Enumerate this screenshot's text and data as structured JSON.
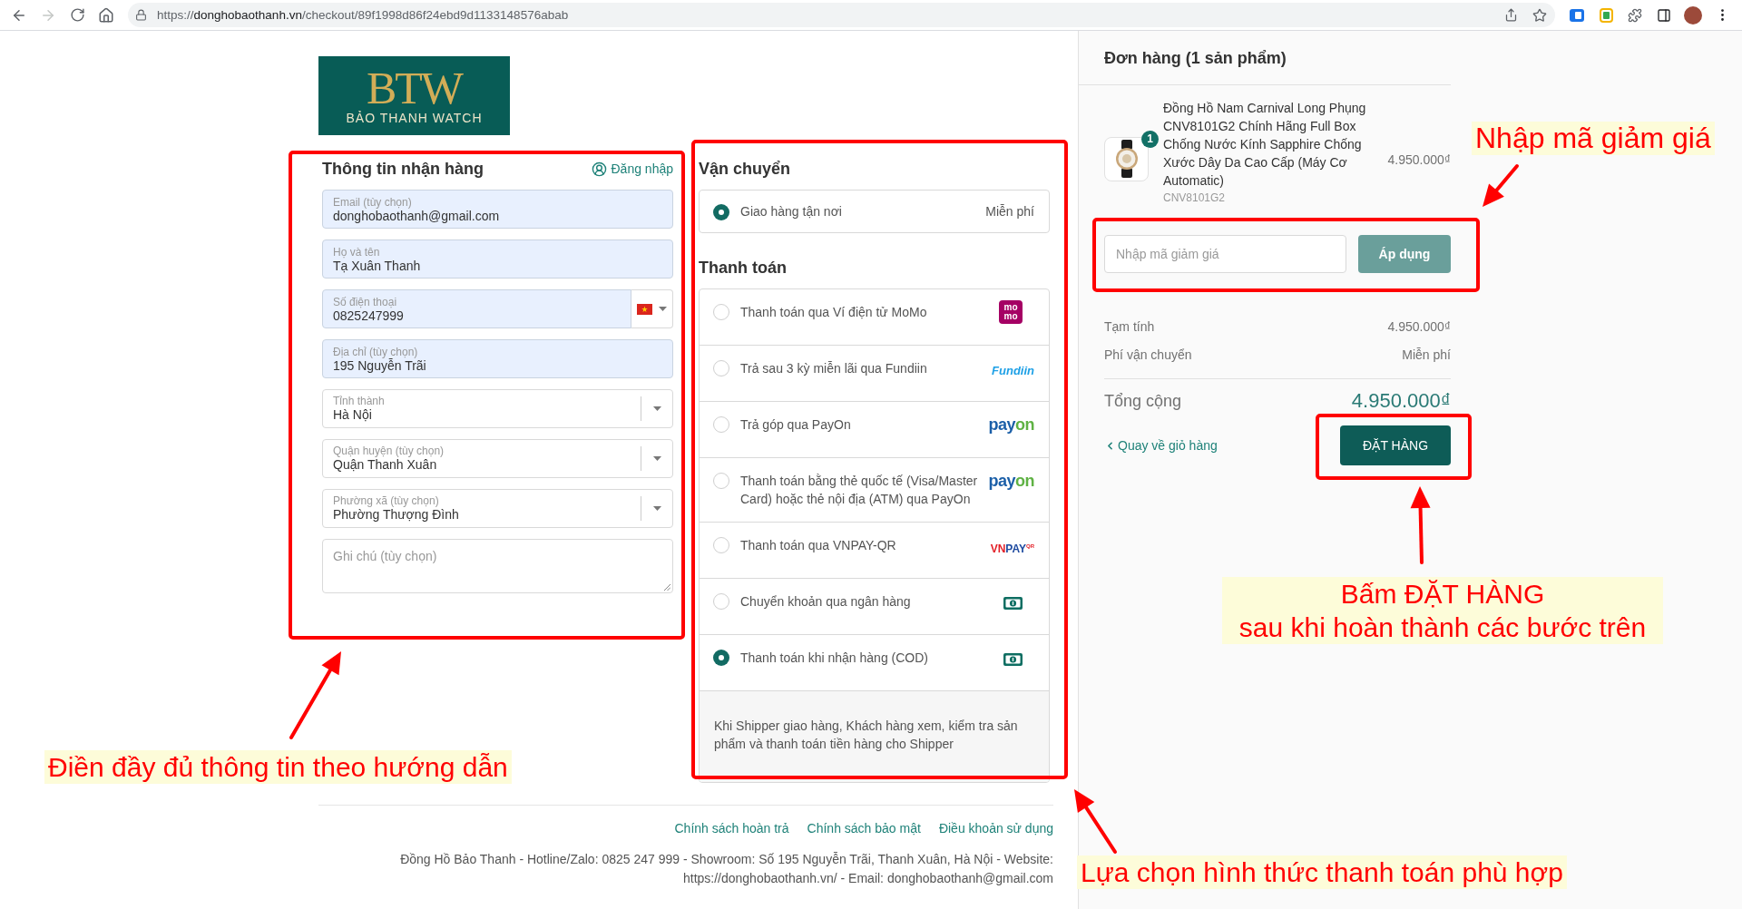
{
  "browser": {
    "back_enabled": true,
    "forward_enabled": false,
    "url": {
      "scheme": "https://",
      "host": "donghobaothanh.vn",
      "path": "/checkout/89f1998d86f24ebd9d1133148576abab"
    }
  },
  "logo": {
    "monogram": "BTW",
    "name": "BẢO THANH WATCH"
  },
  "customer": {
    "title": "Thông tin nhận hàng",
    "login": "Đăng nhập",
    "fields": [
      {
        "kind": "text",
        "label": "Email (tùy chọn)",
        "value": "donghobaothanh@gmail.com",
        "autofilled": true
      },
      {
        "kind": "text",
        "label": "Họ và tên",
        "value": "Tạ Xuân Thanh",
        "autofilled": true
      },
      {
        "kind": "phone",
        "label": "Số điện thoại",
        "value": "0825247999",
        "autofilled": true
      },
      {
        "kind": "text",
        "label": "Địa chỉ (tùy chọn)",
        "value": "195 Nguyễn Trãi",
        "autofilled": true
      },
      {
        "kind": "select",
        "label": "Tỉnh thành",
        "value": "Hà Nội",
        "autofilled": false
      },
      {
        "kind": "select",
        "label": "Quận huyện (tùy chọn)",
        "value": "Quận Thanh Xuân",
        "autofilled": false
      },
      {
        "kind": "select",
        "label": "Phường xã (tùy chọn)",
        "value": "Phường Thượng Đình",
        "autofilled": false
      },
      {
        "kind": "textarea",
        "placeholder": "Ghi chú (tùy chọn)",
        "autofilled": false
      }
    ]
  },
  "shipping": {
    "title": "Vận chuyển",
    "options": [
      {
        "label": "Giao hàng tận nơi",
        "price": "Miễn phí",
        "selected": true
      }
    ]
  },
  "payment": {
    "title": "Thanh toán",
    "methods": [
      {
        "label": "Thanh toán qua Ví điện tử MoMo",
        "selected": false,
        "logo": {
          "kind": "momo",
          "parts": [
            "mo",
            "mo"
          ]
        }
      },
      {
        "label": "Trả sau 3 kỳ miễn lãi qua Fundiin",
        "selected": false,
        "logo": {
          "kind": "fundiin",
          "parts": [
            "Fundiin"
          ]
        }
      },
      {
        "label": "Trả góp qua PayOn",
        "selected": false,
        "logo": {
          "kind": "payon",
          "parts": [
            "pay",
            "on"
          ]
        }
      },
      {
        "label": "Thanh toán bằng thẻ quốc tế (Visa/Master Card) hoặc thẻ nội địa (ATM) qua PayOn",
        "selected": false,
        "logo": {
          "kind": "payon",
          "parts": [
            "pay",
            "on"
          ]
        }
      },
      {
        "label": "Thanh toán qua VNPAY-QR",
        "selected": false,
        "logo": {
          "kind": "vnpay",
          "parts": [
            "VN",
            "PAY",
            "QR"
          ]
        }
      },
      {
        "label": "Chuyển khoản qua ngân hàng",
        "selected": false,
        "logo": {
          "kind": "cash"
        }
      },
      {
        "label": "Thanh toán khi nhận hàng (COD)",
        "selected": true,
        "logo": {
          "kind": "cash"
        }
      }
    ],
    "note": "Khi Shipper giao hàng, Khách hàng xem, kiểm tra sản phẩm và thanh toán tiền hàng cho Shipper"
  },
  "footer": {
    "links": [
      "Chính sách hoàn trả",
      "Chính sách bảo mật",
      "Điều khoản sử dụng"
    ],
    "info": "Đồng Hồ Bảo Thanh - Hotline/Zalo: 0825 247 999 - Showroom: Số 195 Nguyễn Trãi, Thanh Xuân, Hà Nội - Website: https://donghobaothanh.vn/ - Email: donghobaothanh@gmail.com"
  },
  "order": {
    "title": "Đơn hàng (1 sản phẩm)",
    "items": [
      {
        "quantity": "1",
        "name": "Đồng Hồ Nam Carnival Long Phụng CNV8101G2 Chính Hãng Full Box Chống Nước Kính Sapphire Chống Xước Dây Da Cao Cấp (Máy Cơ Automatic)",
        "sku": "CNV8101G2",
        "price": "4.950.000₫"
      }
    ],
    "discount": {
      "placeholder": "Nhập mã giảm giá",
      "button": "Áp dụng"
    },
    "summary": [
      {
        "label": "Tạm tính",
        "value": "4.950.000₫"
      },
      {
        "label": "Phí vận chuyển",
        "value": "Miễn phí"
      }
    ],
    "total": {
      "label": "Tổng cộng",
      "value": "4.950.000₫"
    },
    "back_link": "Quay về giỏ hàng",
    "submit": "ĐẶT HÀNG"
  },
  "annotations": [
    {
      "lines": [
        "Nhập mã giảm giá"
      ]
    },
    {
      "lines": [
        "Bấm ĐẶT HÀNG",
        "sau khi hoàn thành các bước trên"
      ]
    },
    {
      "lines": [
        "Điền đầy đủ thông tin theo hướng dẫn"
      ]
    },
    {
      "lines": [
        "Lựa chọn hình thức thanh toán phù hợp"
      ]
    }
  ]
}
